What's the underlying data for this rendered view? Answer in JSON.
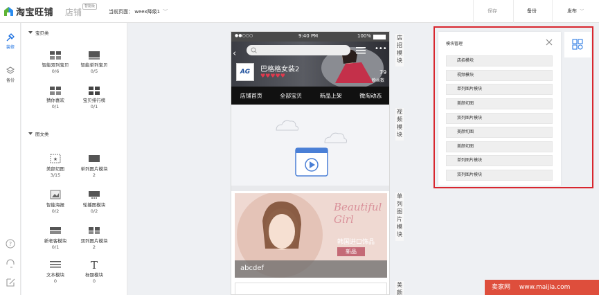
{
  "header": {
    "logo_text": "淘宝旺铺",
    "shop_label": "店铺",
    "badge": "智能版",
    "current_page_label": "当前页面：",
    "current_page_value": "weex降级1",
    "save_label": "保存",
    "backup_label": "备份",
    "publish_label": "发布"
  },
  "leftnav": {
    "items": [
      {
        "label": "装修",
        "icon": "brush-icon",
        "active": true
      },
      {
        "label": "备份",
        "icon": "layers-icon",
        "active": false
      }
    ],
    "bottom_icons": [
      "help-icon",
      "headset-icon",
      "edit-icon"
    ]
  },
  "widgets": {
    "categories": [
      {
        "title": "宝贝类",
        "items": [
          {
            "name": "智能双列宝贝",
            "count": "0/6"
          },
          {
            "name": "智能单列宝贝",
            "count": "0/5"
          },
          {
            "name": "猜你喜欢",
            "count": "0/1"
          },
          {
            "name": "宝贝排行榜",
            "count": "0/1"
          }
        ]
      },
      {
        "title": "图文类",
        "items": [
          {
            "name": "美颜切图",
            "count": "3/15"
          },
          {
            "name": "单列图片模块",
            "count": "2"
          },
          {
            "name": "智能海报",
            "count": "0/2"
          },
          {
            "name": "轮播图模块",
            "count": "0/2"
          },
          {
            "name": "新老客模块",
            "count": "0/1"
          },
          {
            "name": "双列图片模块",
            "count": "2"
          },
          {
            "name": "文本模块",
            "count": "0"
          },
          {
            "name": "标题模块",
            "count": "0"
          }
        ]
      }
    ]
  },
  "phone": {
    "status": {
      "carrier": "●●○○○",
      "time": "9:40 PM",
      "battery": "100%"
    },
    "shop_logo": "AG",
    "shop_name": "巴格格女装2",
    "hearts": "♥♥♥♥♥",
    "fans_count": "79",
    "fans_label": "粉丝数",
    "nav_tabs": [
      "店铺首页",
      "全部宝贝",
      "新品上架",
      "微淘动态"
    ],
    "banner": {
      "script_text": "Beautiful Girl",
      "cn_text": "韩国进口饰品",
      "tag": "新品",
      "caption": "abcdef",
      "logo": "Chic"
    },
    "side_labels": [
      "店招模块",
      "视频模块",
      "单列图片模块",
      "美颜"
    ]
  },
  "module_manager": {
    "title": "模块管理",
    "items": [
      "店招模块",
      "视频模块",
      "单列图片模块",
      "美颜切图",
      "双列图片模块",
      "美颜切图",
      "美颜切图",
      "单列图片模块",
      "双列图片模块"
    ]
  },
  "watermark": {
    "brand": "卖家网",
    "url": "www.maijia.com"
  },
  "colors": {
    "accent": "#1a6fe0",
    "highlight_frame": "#d8262e",
    "nav_bar": "#111111"
  }
}
